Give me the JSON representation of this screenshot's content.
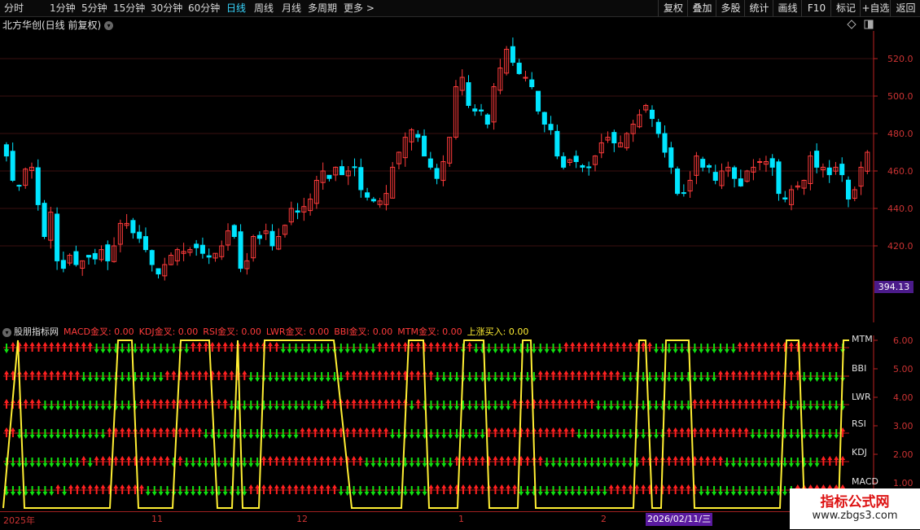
{
  "toolbar": {
    "periods": [
      "分时",
      "1分钟",
      "5分钟",
      "15分钟",
      "30分钟",
      "60分钟",
      "日线",
      "周线",
      "月线",
      "多周期",
      "更多 >"
    ],
    "active_period": "日线",
    "right_buttons": [
      "复权",
      "叠加",
      "多股",
      "统计",
      "画线",
      "F10",
      "标记",
      "+自选",
      "返回"
    ]
  },
  "main_chart": {
    "title": "北方华创(日线 前复权)",
    "price_axis": [
      "520.0",
      "500.0",
      "480.0",
      "460.0",
      "440.0",
      "420.0"
    ],
    "current_price": "394.13",
    "colors": {
      "up": "#ff3b3b",
      "down": "#00e5ff",
      "grid": "#3a0f0f",
      "axis": "#b22"
    }
  },
  "indicator_panel": {
    "name": "股朋指标网",
    "values": [
      {
        "label": "MACD金叉: 0.00",
        "color": "#ff3b3b"
      },
      {
        "label": "KDJ金叉: 0.00",
        "color": "#ff3b3b"
      },
      {
        "label": "RSI金叉: 0.00",
        "color": "#ff3b3b"
      },
      {
        "label": "LWR金叉: 0.00",
        "color": "#ff3b3b"
      },
      {
        "label": "BBI金叉: 0.00",
        "color": "#ff3b3b"
      },
      {
        "label": "MTM金叉: 0.00",
        "color": "#ff3b3b"
      },
      {
        "label": "上涨买入: 0.00",
        "color": "#ffee33"
      }
    ],
    "axis": [
      "6.00",
      "5.00",
      "4.00",
      "3.00",
      "2.00",
      "1.00"
    ],
    "row_labels": [
      "MTM",
      "BBI",
      "LWR",
      "RSI",
      "KDJ",
      "MACD"
    ]
  },
  "date_axis": {
    "labels": [
      "2025年",
      "11",
      "12",
      "1",
      "2"
    ],
    "cursor": "2026/02/11/三"
  },
  "watermark": {
    "line1": "指标公式网",
    "line2": "www.zbgs3.com"
  }
}
